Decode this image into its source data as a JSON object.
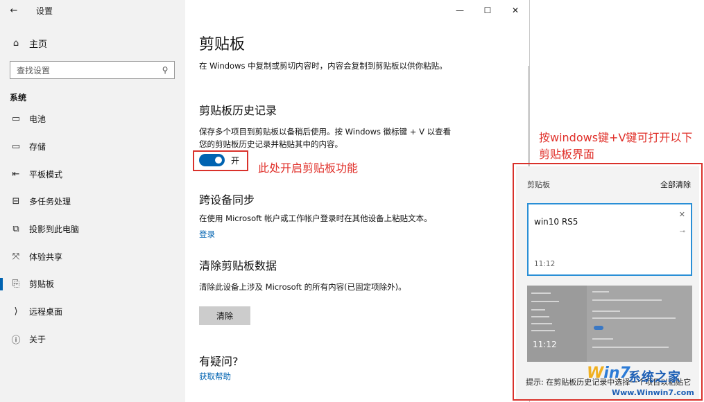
{
  "window": {
    "app_title": "设置",
    "back_icon": "←",
    "minimize_icon": "—",
    "maximize_icon": "☐",
    "close_icon": "✕"
  },
  "sidebar": {
    "home_label": "主页",
    "search_placeholder": "查找设置",
    "section_label": "系统",
    "items": [
      {
        "label": "电池",
        "icon": "battery-icon",
        "glyph": "▭",
        "active": false
      },
      {
        "label": "存储",
        "icon": "storage-icon",
        "glyph": "▭",
        "active": false
      },
      {
        "label": "平板模式",
        "icon": "tablet-mode-icon",
        "glyph": "⇤",
        "active": false
      },
      {
        "label": "多任务处理",
        "icon": "multitasking-icon",
        "glyph": "⊟",
        "active": false
      },
      {
        "label": "投影到此电脑",
        "icon": "projecting-icon",
        "glyph": "⧉",
        "active": false
      },
      {
        "label": "体验共享",
        "icon": "shared-experiences-icon",
        "glyph": "⤧",
        "active": false
      },
      {
        "label": "剪贴板",
        "icon": "clipboard-icon",
        "glyph": "⎘",
        "active": true
      },
      {
        "label": "远程桌面",
        "icon": "remote-desktop-icon",
        "glyph": "⟩",
        "active": false
      },
      {
        "label": "关于",
        "icon": "about-icon",
        "glyph": "ⓘ",
        "active": false
      }
    ]
  },
  "content": {
    "title": "剪贴板",
    "description": "在 Windows 中复制或剪切内容时，内容会复制到剪贴板以供你粘贴。",
    "history": {
      "heading": "剪贴板历史记录",
      "text": "保存多个项目到剪贴板以备稍后使用。按 Windows 徽标键 + V 以查看您的剪贴板历史记录并粘贴其中的内容。",
      "toggle_label": "开",
      "toggle_on": true
    },
    "sync": {
      "heading": "跨设备同步",
      "text": "在使用 Microsoft 帐户或工作帐户登录时在其他设备上粘贴文本。",
      "link": "登录"
    },
    "clear": {
      "heading": "清除剪贴板数据",
      "text": "清除此设备上涉及 Microsoft 的所有内容(已固定项除外)。",
      "button": "清除"
    },
    "help": {
      "heading": "有疑问?",
      "link": "获取帮助"
    }
  },
  "annotations": {
    "toggle_note": "此处开启剪贴板功能",
    "popup_note_line1": "按windows键+V键可打开以下",
    "popup_note_line2": "剪贴板界面",
    "color": "#e0302a"
  },
  "clipboard_popup": {
    "title": "剪贴板",
    "clear_all": "全部清除",
    "items": [
      {
        "text": "win10 RS5",
        "time": "11:12"
      },
      {
        "time": "11:12"
      }
    ],
    "hint": "提示: 在剪贴板历史记录中选择一个项目以粘贴它"
  },
  "watermark": {
    "logo": "Win7",
    "name": "系统之家",
    "url": "Www.Winwin7.com"
  },
  "colors": {
    "accent": "#0063b1",
    "annotation": "#d9312b",
    "sidebar_bg": "#f2f2f2"
  }
}
